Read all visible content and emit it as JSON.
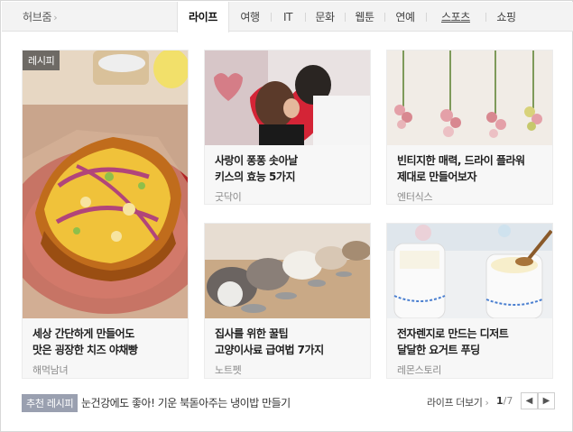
{
  "hub": {
    "label": "허브줌"
  },
  "tabs": [
    {
      "label": "라이프",
      "active": true
    },
    {
      "label": "여행"
    },
    {
      "label": "IT"
    },
    {
      "label": "문화"
    },
    {
      "label": "웹툰"
    },
    {
      "label": "연예"
    },
    {
      "label": "스포츠"
    },
    {
      "label": "쇼핑"
    }
  ],
  "featured": {
    "badge": "레시피",
    "title_line1": "세상 간단하게 만들어도",
    "title_line2": "맛은 굉장한 치즈 야채빵",
    "source": "해먹남녀"
  },
  "cards": [
    {
      "title_line1": "사랑이 퐁퐁 솟아날",
      "title_line2": "키스의 효능 5가지",
      "source": "굿닥이"
    },
    {
      "title_line1": "빈티지한 매력, 드라이 플라워",
      "title_line2": "제대로 만들어보자",
      "source": "엔터식스"
    },
    {
      "title_line1": "집사를 위한 꿀팁",
      "title_line2": "고양이사료 급여법 7가지",
      "source": "노트펫"
    },
    {
      "title_line1": "전자렌지로 만드는 디저트",
      "title_line2": "달달한 요거트 푸딩",
      "source": "레몬스토리"
    }
  ],
  "bottom": {
    "rec_badge": "추천 레시피",
    "rec_text": "눈건강에도 좋아! 기운 북돋아주는 냉이밥 만들기",
    "more_label": "라이프 더보기",
    "page_current": "1",
    "page_total": "/7"
  },
  "colors": {
    "accent_active_tab": "#111111",
    "badge_bg": "#9aa0b0"
  }
}
